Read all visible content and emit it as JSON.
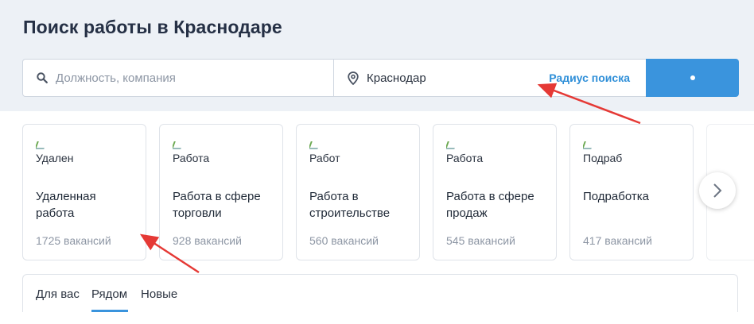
{
  "page": {
    "title": "Поиск работы в Краснодаре"
  },
  "search": {
    "position_placeholder": "Должность, компания",
    "location_value": "Краснодар",
    "radius_label": "Радиус поиска"
  },
  "cards": [
    {
      "image_alt": "Удален",
      "name": "Удаленная работа",
      "count": "1725 вакансий"
    },
    {
      "image_alt": "Работа",
      "name": "Работа в сфере торговли",
      "count": "928 вакансий"
    },
    {
      "image_alt": "Работ",
      "name": "Работа в строительстве",
      "count": "560 вакансий"
    },
    {
      "image_alt": "Работа",
      "name": "Работа в сфере продаж",
      "count": "545 вакансий"
    },
    {
      "image_alt": "Подраб",
      "name": "Подработка",
      "count": "417 вакансий"
    }
  ],
  "tabs": [
    {
      "label": "Для вас"
    },
    {
      "label": "Рядом"
    },
    {
      "label": "Новые"
    }
  ],
  "colors": {
    "accent": "#3a94dd",
    "annotation": "#e53935",
    "header_bg": "#edf1f6"
  }
}
